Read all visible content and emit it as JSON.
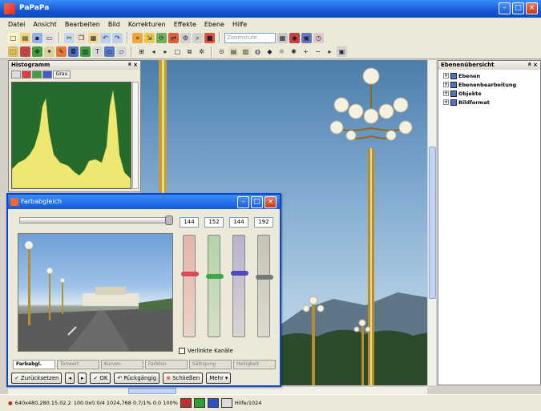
{
  "window": {
    "title": "PaPaPa"
  },
  "menu": [
    "Datei",
    "Ansicht",
    "Bearbeiten",
    "Bild",
    "Korrekturen",
    "Effekte",
    "Ebene",
    "Hilfe"
  ],
  "toolbar1": {
    "zoom_placeholder": "Zoomstufe"
  },
  "histogram": {
    "title": "Histogramm",
    "gray_tab": "Grau"
  },
  "layers": {
    "title": "Ebenenübersicht",
    "items": [
      "Ebenen",
      "Ebenenbearbeitung",
      "Objekte",
      "Bildformat"
    ]
  },
  "dialog": {
    "title": "Farbabgleich",
    "values": [
      "144",
      "152",
      "144",
      "192"
    ],
    "channel_levels": [
      0.36,
      0.38,
      0.35,
      0.39
    ],
    "channel_colors": [
      "#d84a54",
      "#3ca848",
      "#5048b8",
      "#787878"
    ],
    "linked_label": "Verlinkte Kanäle",
    "tabs": [
      "Farbabgl.",
      "Tonwert",
      "Kurven",
      "Farbton",
      "Sättigung",
      "Helligkeit"
    ],
    "buttons": {
      "reset": "Zurücksetzen",
      "ok": "OK",
      "undo": "Rückgängig",
      "close": "Schließen",
      "more": "Mehr"
    }
  },
  "status": {
    "coords": "640x480,280.15.02.2",
    "info": "100.0x0.0/4  1024,768 0.7/1% 0.0  100%",
    "swatches": [
      "#c03030",
      "#30a030",
      "#3050c0",
      "#dcdcdc"
    ],
    "extra": "Hilfe/1024"
  }
}
